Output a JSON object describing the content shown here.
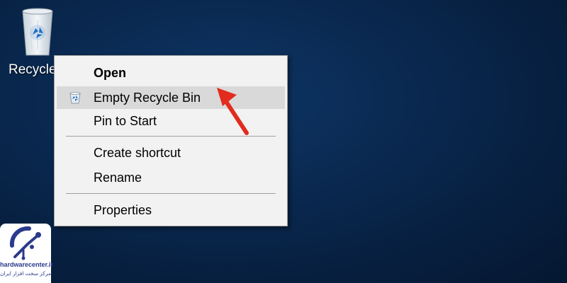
{
  "desktop": {
    "recycle_bin_label": "Recycle"
  },
  "context_menu": {
    "items": [
      {
        "label": "Open",
        "bold": true
      },
      {
        "label": "Empty Recycle Bin",
        "highlighted": true,
        "icon": "recycle-bin-icon"
      },
      {
        "label": "Pin to Start"
      },
      {
        "label": "Create shortcut"
      },
      {
        "label": "Rename"
      },
      {
        "label": "Properties"
      }
    ]
  },
  "annotation": {
    "arrow_color": "#e32b1e"
  },
  "watermark": {
    "site": "hardwarecenter.ir",
    "tagline": "مرکز سخت افزار ایران"
  },
  "colors": {
    "desktop_background": "#0a2a52",
    "menu_background": "#f2f2f2",
    "highlight": "#d9d9d9",
    "logo_blue": "#2b3a8c"
  }
}
